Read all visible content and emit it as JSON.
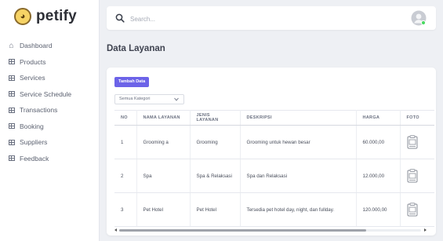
{
  "brand": {
    "name": "petify",
    "logo_icon": "dog-logo-icon"
  },
  "sidebar": {
    "items": [
      {
        "label": "Dashboard",
        "icon": "home-icon"
      },
      {
        "label": "Products",
        "icon": "table-icon"
      },
      {
        "label": "Services",
        "icon": "table-icon"
      },
      {
        "label": "Service Schedule",
        "icon": "table-icon"
      },
      {
        "label": "Transactions",
        "icon": "table-icon"
      },
      {
        "label": "Booking",
        "icon": "table-icon"
      },
      {
        "label": "Suppliers",
        "icon": "table-icon"
      },
      {
        "label": "Feedback",
        "icon": "table-icon"
      }
    ]
  },
  "topbar": {
    "search_placeholder": "Search..."
  },
  "page": {
    "title": "Data Layanan"
  },
  "card": {
    "add_label": "Tambah Data",
    "category_value": "Semua Kategori",
    "columns": [
      "NO",
      "NAMA LAYANAN",
      "JENIS LAYANAN",
      "DESKRIPSI",
      "HARGA",
      "FOTO"
    ],
    "rows": [
      {
        "no": "1",
        "nama": "Grooming a",
        "jenis": "Grooming",
        "deskripsi": "Grooming untuk hewan besar",
        "harga": "60.000,00"
      },
      {
        "no": "2",
        "nama": "Spa",
        "jenis": "Spa & Relaksasi",
        "deskripsi": "Spa dan Relaksasi",
        "harga": "12.000,00"
      },
      {
        "no": "3",
        "nama": "Pet Hotel",
        "jenis": "Pet Hotel",
        "deskripsi": "Tersedia pet hotel day, night, dan fullday.",
        "harga": "120.000,00"
      }
    ]
  },
  "colors": {
    "accent": "#6c63e8",
    "background": "#eef0f4",
    "avatar_status": "#4cd964"
  }
}
